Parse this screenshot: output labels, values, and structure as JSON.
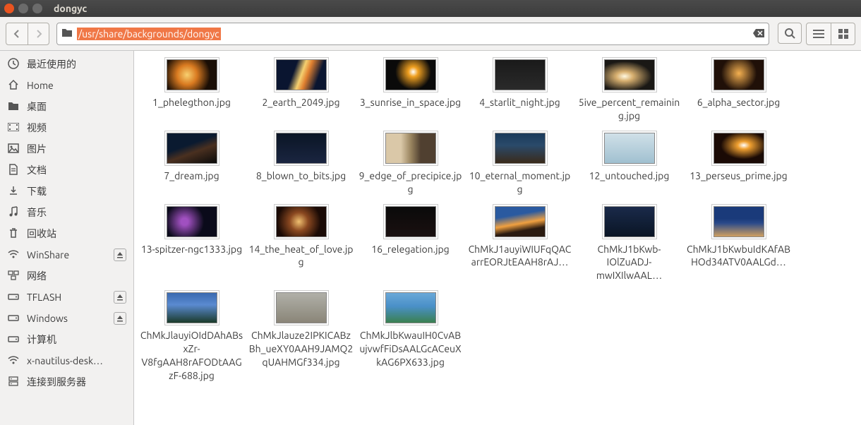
{
  "window": {
    "title": "dongyc"
  },
  "path": {
    "text": "/usr/share/backgrounds/dongyc"
  },
  "sidebar": {
    "items": [
      {
        "icon": "clock",
        "label": "最近使用的",
        "eject": false
      },
      {
        "icon": "home",
        "label": "Home",
        "eject": false
      },
      {
        "icon": "folder",
        "label": "桌面",
        "eject": false
      },
      {
        "icon": "video",
        "label": "视频",
        "eject": false
      },
      {
        "icon": "image",
        "label": "图片",
        "eject": false
      },
      {
        "icon": "doc",
        "label": "文档",
        "eject": false
      },
      {
        "icon": "download",
        "label": "下载",
        "eject": false
      },
      {
        "icon": "music",
        "label": "音乐",
        "eject": false
      },
      {
        "icon": "trash",
        "label": "回收站",
        "eject": false
      },
      {
        "icon": "wifi",
        "label": "WinShare",
        "eject": true
      },
      {
        "icon": "network",
        "label": "网络",
        "eject": false
      },
      {
        "icon": "drive",
        "label": "TFLASH",
        "eject": true
      },
      {
        "icon": "drive",
        "label": "Windows",
        "eject": true
      },
      {
        "icon": "drive",
        "label": "计算机",
        "eject": false
      },
      {
        "icon": "wifi",
        "label": "x-nautilus-desk…",
        "eject": false
      },
      {
        "icon": "server",
        "label": "连接到服务器",
        "eject": false
      }
    ]
  },
  "files": [
    {
      "name": "1_phelegthon.jpg",
      "thumb": "t1"
    },
    {
      "name": "2_earth_2049.jpg",
      "thumb": "t2"
    },
    {
      "name": "3_sunrise_in_space.jpg",
      "thumb": "t3"
    },
    {
      "name": "4_starlit_night.jpg",
      "thumb": "t4"
    },
    {
      "name": "5ive_percent_remaining.jpg",
      "thumb": "t5"
    },
    {
      "name": "6_alpha_sector.jpg",
      "thumb": "t6"
    },
    {
      "name": "7_dream.jpg",
      "thumb": "t7"
    },
    {
      "name": "8_blown_to_bits.jpg",
      "thumb": "t8"
    },
    {
      "name": "9_edge_of_precipice.jpg",
      "thumb": "t9"
    },
    {
      "name": "10_eternal_moment.jpg",
      "thumb": "t10"
    },
    {
      "name": "12_untouched.jpg",
      "thumb": "t11"
    },
    {
      "name": "13_perseus_prime.jpg",
      "thumb": "t12"
    },
    {
      "name": "13-spitzer-ngc1333.jpg",
      "thumb": "t13"
    },
    {
      "name": "14_the_heat_of_love.jpg",
      "thumb": "t14"
    },
    {
      "name": "16_relegation.jpg",
      "thumb": "t15"
    },
    {
      "name": "ChMkJ1auyiWIUFqQACarrEORJtEAAH8rAJ…",
      "thumb": "t16"
    },
    {
      "name": "ChMkJ1bKwb-IOlZuADJ-mwIXIlwAAL…",
      "thumb": "t17"
    },
    {
      "name": "ChMkJ1bKwbuIdKAfABHOd34ATV0AALGd…",
      "thumb": "t18"
    },
    {
      "name": "ChMkJlauyiOIdDAhABsxZr-V8fgAAH8rAFODtAAGzF-688.jpg",
      "thumb": "t19"
    },
    {
      "name": "ChMkJlauze2IPKICABzBh_ueXY0AAH9JAMQ2qUAHMGf334.jpg",
      "thumb": "t20"
    },
    {
      "name": "ChMkJlbKwauIH0CvABujvwfFiDsAALGcACeuXkAG6PX633.jpg",
      "thumb": "t21"
    }
  ]
}
